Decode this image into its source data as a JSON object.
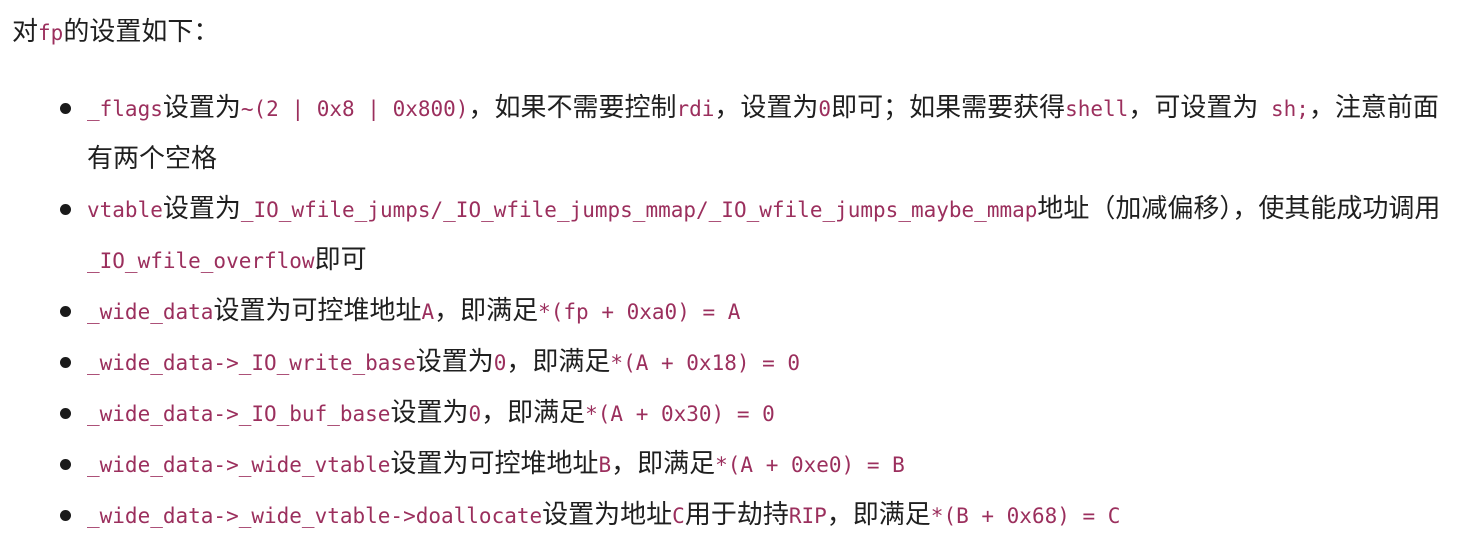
{
  "intro": [
    "对",
    "fp",
    "的设置如下："
  ],
  "items": [
    [
      "_flags",
      "设置为",
      "~(2 | 0x8 | 0x800)",
      "，如果不需要控制",
      "rdi",
      "，设置为",
      "0",
      "即可；如果需要获得",
      "shell",
      "，可设置为",
      " sh;",
      "，注意前面有两个空格"
    ],
    [
      "vtable",
      "设置为",
      "_IO_wfile_jumps/_IO_wfile_jumps_mmap/_IO_wfile_jumps_maybe_mmap",
      "地址（加减偏移），使其能成功调用",
      "_IO_wfile_overflow",
      "即可"
    ],
    [
      "_wide_data",
      "设置为可控堆地址",
      "A",
      "，即满足",
      "*(fp + 0xa0) = A"
    ],
    [
      "_wide_data->_IO_write_base",
      "设置为",
      "0",
      "，即满足",
      "*(A + 0x18) = 0"
    ],
    [
      "_wide_data->_IO_buf_base",
      "设置为",
      "0",
      "，即满足",
      "*(A + 0x30) = 0"
    ],
    [
      "_wide_data->_wide_vtable",
      "设置为可控堆地址",
      "B",
      "，即满足",
      "*(A + 0xe0) = B"
    ],
    [
      "_wide_data->_wide_vtable->doallocate",
      "设置为地址",
      "C",
      "用于劫持",
      "RIP",
      "，即满足",
      "*(B + 0x68) = C"
    ]
  ]
}
